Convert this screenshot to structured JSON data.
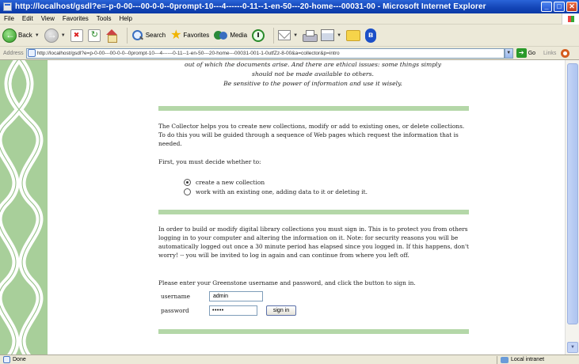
{
  "window": {
    "title": "http://localhost/gsdl?e=-p-0-00---00-0-0--0prompt-10---4------0-11--1-en-50---20-home---00031-00 - Microsoft Internet Explorer",
    "minimize": "_",
    "maximize": "□",
    "close": "✕"
  },
  "menu": [
    "File",
    "Edit",
    "View",
    "Favorites",
    "Tools",
    "Help"
  ],
  "toolbar": {
    "back": "Back",
    "search": "Search",
    "favorites": "Favorites",
    "media": "Media"
  },
  "address": {
    "label": "Address",
    "url": "http://localhost/gsdl?e=p-0-00---00-0-0--0prompt-10---4------0-11--1-en-50---20-home---00031-001-1-0utfZz-8-00&a=collector&p=intro",
    "go": "Go",
    "links": "Links"
  },
  "page": {
    "quote": [
      "out of which the documents arise. And there are ethical issues: some things simply",
      "should not be made available to others.",
      "Be sensitive to the power of information and use it wisely."
    ],
    "intro": "The Collector helps you to create new collections, modify or add to existing ones, or delete collections. To do this you will be guided through a sequence of Web pages which request the information that is needed.",
    "decide": "First, you must decide whether to:",
    "options": [
      {
        "label": "create a new collection",
        "selected": true
      },
      {
        "label": "work with an existing one, adding data to it or deleting it.",
        "selected": false
      }
    ],
    "signin_info": "In order to build or modify digital library collections you must sign in. This is to protect you from others logging in to your computer and altering the information on it. Note: for security reasons you will be automatically logged out once a 30 minute period has elapsed since you logged in. If this happens, don't worry! -- you will be invited to log in again and can continue from where you left off.",
    "prompt": "Please enter your Greenstone username and password, and click the button to sign in.",
    "username_label": "username",
    "username_value": "admin",
    "password_label": "password",
    "password_value": "•••••",
    "signin_button": "sign in"
  },
  "status": {
    "text": "Done",
    "zone": "Local intranet"
  },
  "colors": {
    "accent_green": "#b4d7a8",
    "strip_green": "#a8cf9a"
  }
}
